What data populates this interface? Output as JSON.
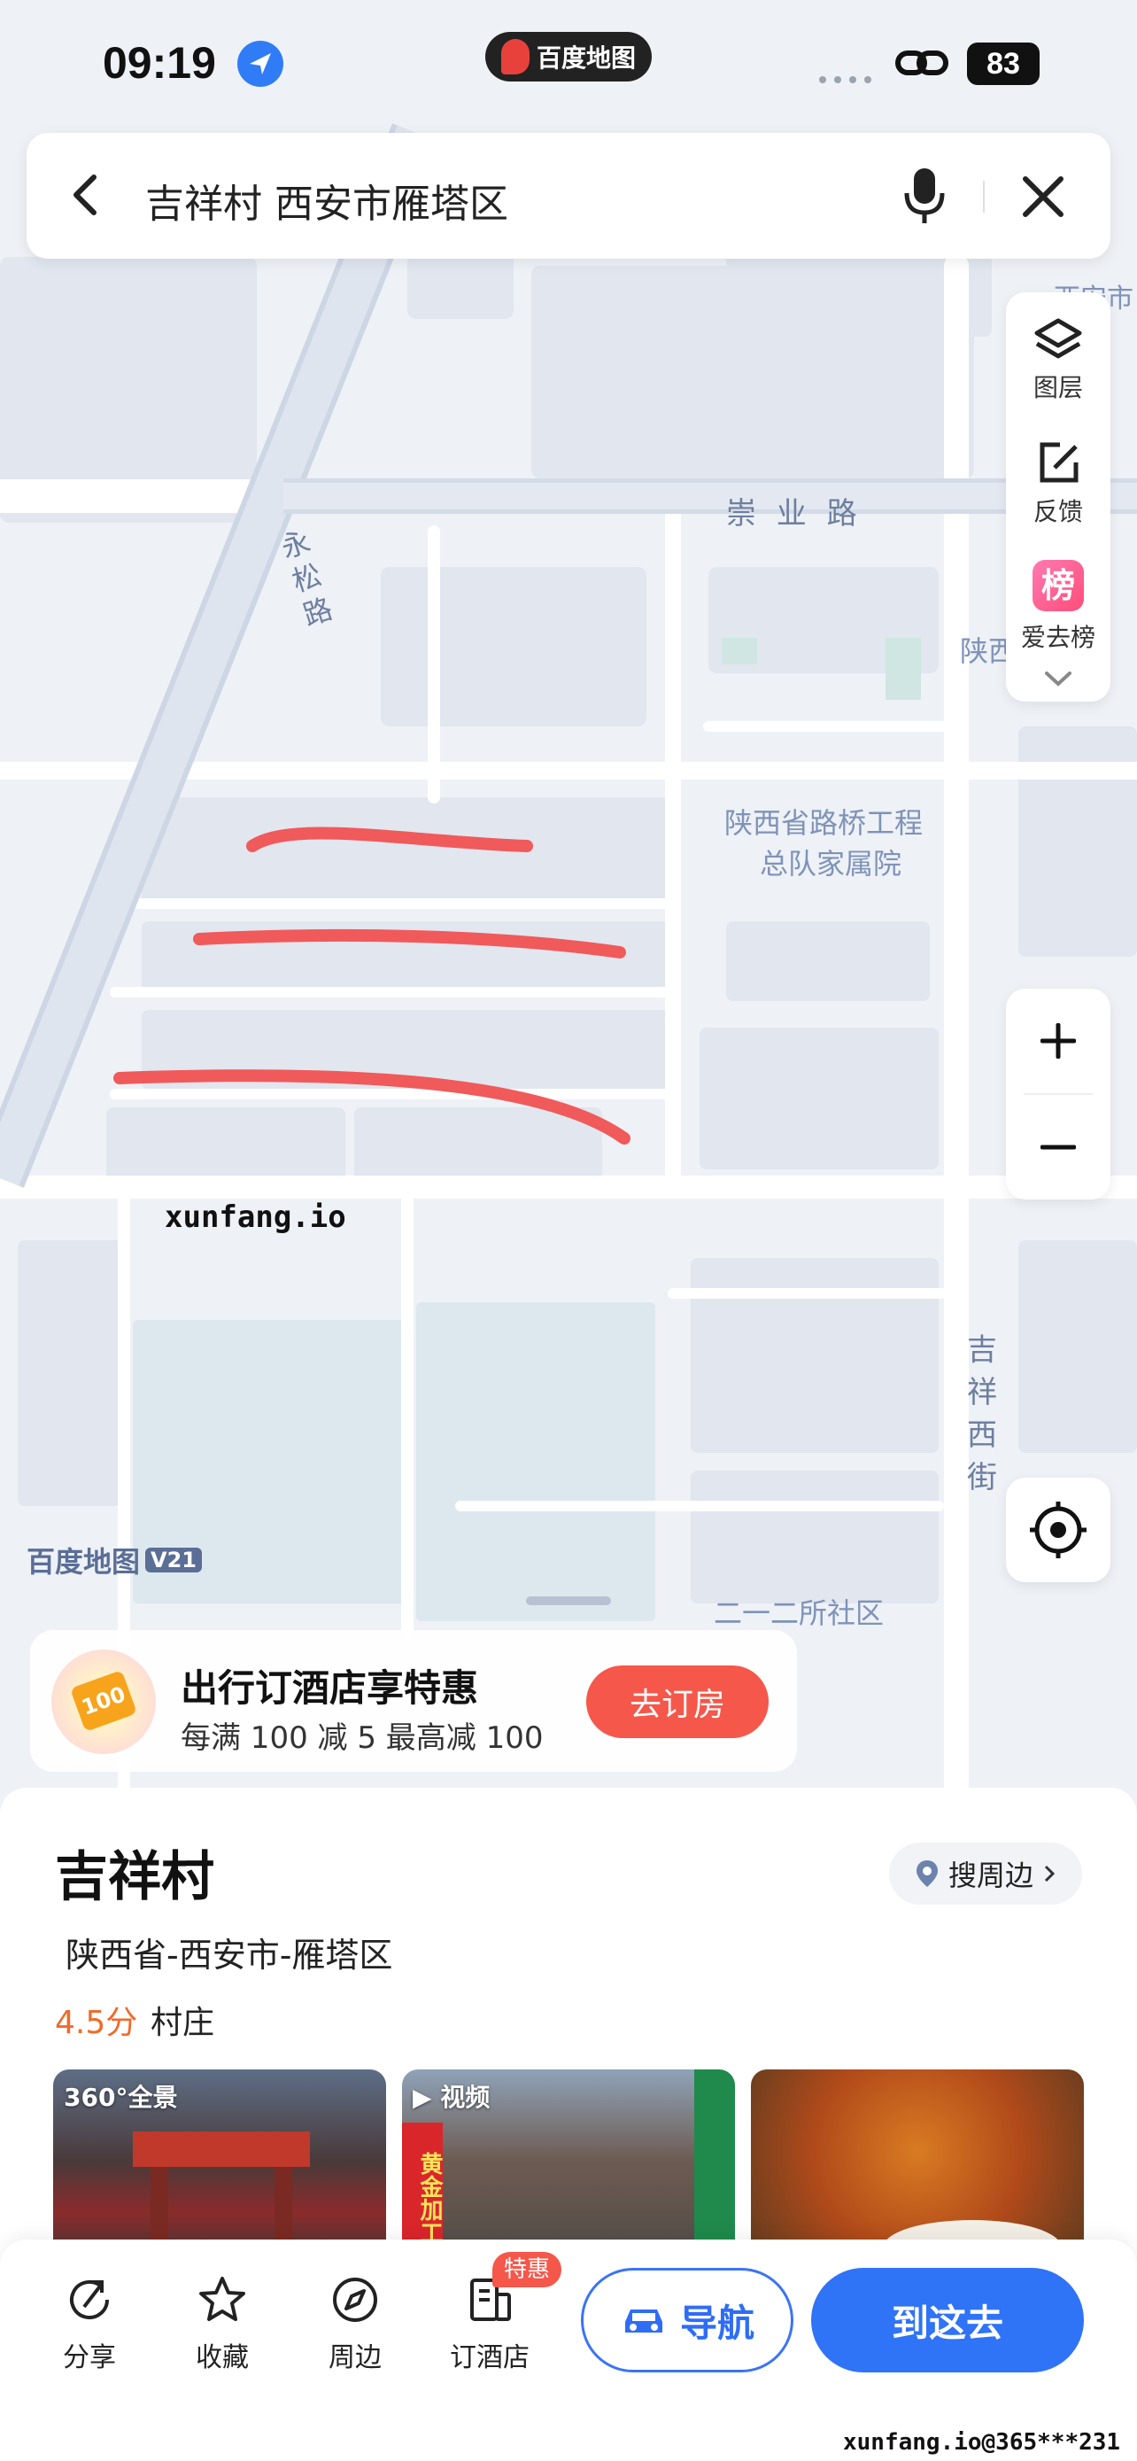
{
  "status_bar": {
    "time": "09:19",
    "app_name": "百度地图",
    "battery": "83"
  },
  "search": {
    "query": "吉祥村 西安市雁塔区"
  },
  "map": {
    "roads": {
      "chongye_road": "崇 业 路",
      "yongsong_road": [
        "永",
        "松",
        "路"
      ],
      "jixiang_west_street": [
        "吉",
        "祥",
        "西",
        "街"
      ]
    },
    "pois": {
      "shaanxi_bridge_line1": "陕西省路桥工程",
      "shaanxi_bridge_line2": "总队家属院",
      "community_212": "二一二所社区",
      "top_right_partial": "西安市",
      "right_partial": "陕西"
    },
    "watermark_text": "xunfang.io",
    "brand": "百度地图",
    "brand_version": "V21"
  },
  "side_tools": [
    {
      "label": "图层",
      "icon": "layers-icon"
    },
    {
      "label": "反馈",
      "icon": "feedback-icon"
    },
    {
      "label": "爱去榜",
      "icon": "ranking-icon",
      "badge": "榜"
    }
  ],
  "promo": {
    "title": "出行订酒店享特惠",
    "subtitle": "每满 100 减 5   最高减 100",
    "coupon_value": "100",
    "button": "去订房"
  },
  "place": {
    "name": "吉祥村",
    "nearby_button": "搜周边",
    "address": "陕西省-西安市-雁塔区",
    "rating": "4.5分",
    "category": "村庄",
    "photos": [
      {
        "badge": "360°全景",
        "caption": ""
      },
      {
        "badge": "视频",
        "caption": "黄金加工"
      },
      {
        "badge": "",
        "caption": ""
      }
    ]
  },
  "actions": [
    {
      "label": "分享",
      "icon": "share-icon"
    },
    {
      "label": "收藏",
      "icon": "star-icon"
    },
    {
      "label": "周边",
      "icon": "compass-icon"
    },
    {
      "label": "订酒店",
      "icon": "hotel-icon",
      "badge": "特惠"
    }
  ],
  "navigate_button": "导航",
  "go_button": "到这去",
  "footer_watermark": "xunfang.io@365***231",
  "colors": {
    "accent": "#2f73f6",
    "promo_red": "#f5574a",
    "marker_red": "#f05a5a",
    "rating_orange": "#f06a2a"
  }
}
